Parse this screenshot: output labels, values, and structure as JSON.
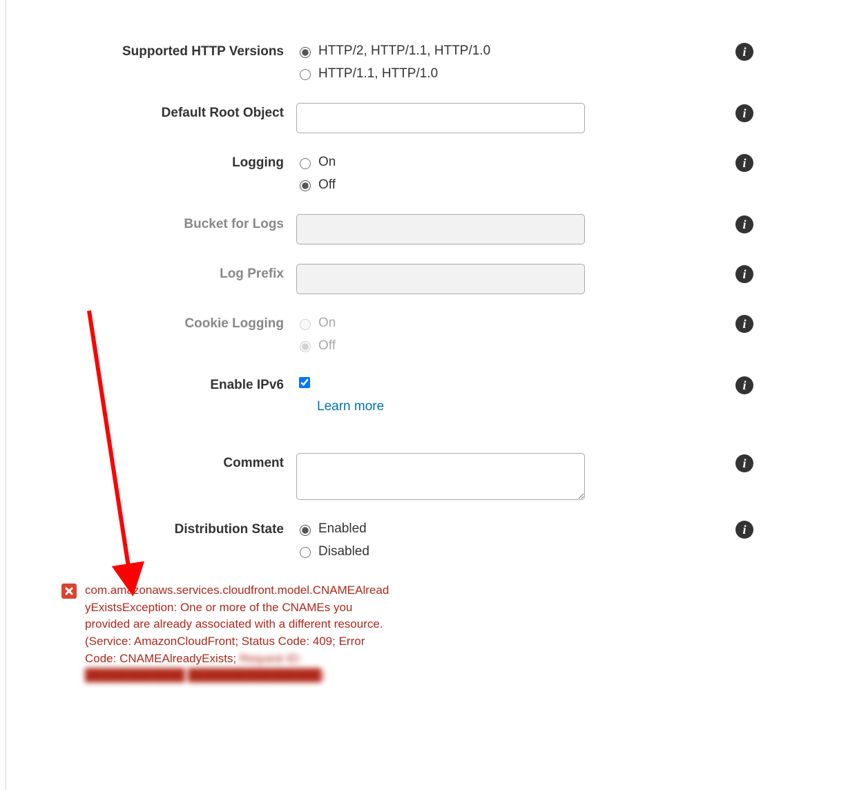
{
  "form": {
    "http_versions": {
      "label": "Supported HTTP Versions",
      "opt1": "HTTP/2, HTTP/1.1, HTTP/1.0",
      "opt2": "HTTP/1.1, HTTP/1.0",
      "selected": "opt1"
    },
    "default_root_object": {
      "label": "Default Root Object",
      "value": ""
    },
    "logging": {
      "label": "Logging",
      "opt_on": "On",
      "opt_off": "Off",
      "selected": "off"
    },
    "bucket_for_logs": {
      "label": "Bucket for Logs",
      "value": ""
    },
    "log_prefix": {
      "label": "Log Prefix",
      "value": ""
    },
    "cookie_logging": {
      "label": "Cookie Logging",
      "opt_on": "On",
      "opt_off": "Off",
      "selected": "off"
    },
    "enable_ipv6": {
      "label": "Enable IPv6",
      "checked": true,
      "learn_more": "Learn more"
    },
    "comment": {
      "label": "Comment",
      "value": ""
    },
    "distribution_state": {
      "label": "Distribution State",
      "opt_enabled": "Enabled",
      "opt_disabled": "Disabled",
      "selected": "enabled"
    }
  },
  "error": {
    "message": "com.amazonaws.services.cloudfront.model.CNAMEAlreadyExistsException: One or more of the CNAMEs you provided are already associated with a different resource. (Service: AmazonCloudFront; Status Code: 409; Error Code: CNAMEAlreadyExists;",
    "redacted": "Request ID: ████████████ ████████████████)"
  }
}
